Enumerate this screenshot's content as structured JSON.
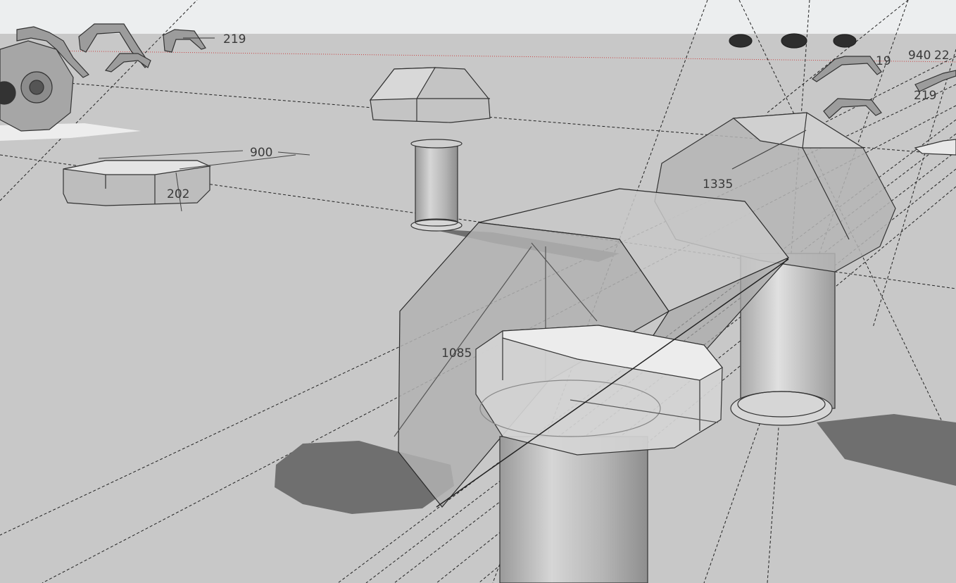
{
  "viewport": {
    "sky_color": "#eef0f1",
    "ground_color": "#c8c8c8",
    "horizon_line_color": "#c83c3c"
  },
  "dimensions": {
    "left_arm_label": "219",
    "slab_width": "900",
    "slab_height": "202",
    "cap_diagonal": "1335",
    "main_block_height": "1085",
    "right_arm_label_a": "19",
    "right_arm_label_b": "219",
    "right_arm_label_c": "940",
    "right_arm_label_d": "22"
  }
}
